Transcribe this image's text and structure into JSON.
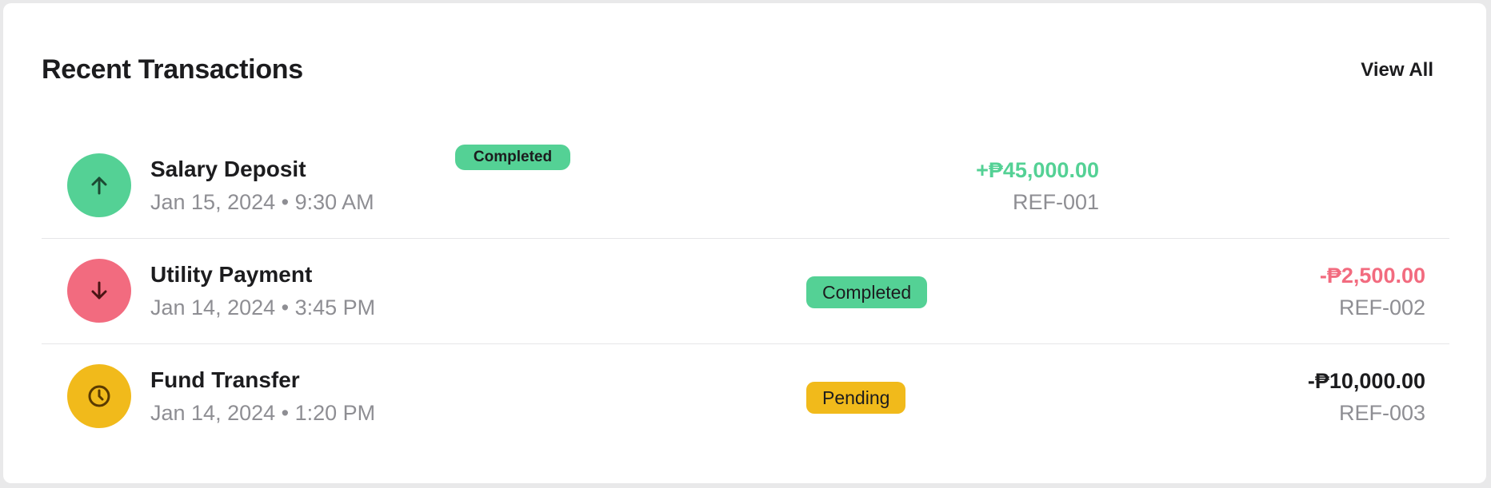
{
  "card": {
    "title": "Recent Transactions",
    "view_all_label": "View All"
  },
  "colors": {
    "green": "#54d195",
    "red": "#f26b7f",
    "yellow": "#f1ba1b",
    "dark_red": "#4a1414",
    "dark_yellow": "#5a3a00"
  },
  "transactions": [
    {
      "name": "Salary Deposit",
      "date": "Jan 15, 2024 • 9:30 AM",
      "status": "Completed",
      "amount": "+₱45,000.00",
      "ref": "REF-001",
      "icon": "arrow-up-icon",
      "amount_color": "#54d195",
      "icon_bg": "#54d195",
      "badge_bg": "#54d195"
    },
    {
      "name": "Utility Payment",
      "date": "Jan 14, 2024 • 3:45 PM",
      "status": "Completed",
      "amount": "-₱2,500.00",
      "ref": "REF-002",
      "icon": "arrow-down-icon",
      "amount_color": "#f26b7f",
      "icon_bg": "#f26b7f",
      "badge_bg": "#54d195"
    },
    {
      "name": "Fund Transfer",
      "date": "Jan 14, 2024 • 1:20 PM",
      "status": "Pending",
      "amount": "-₱10,000.00",
      "ref": "REF-003",
      "icon": "clock-icon",
      "amount_color": "#1c1c1e",
      "icon_bg": "#f1ba1b",
      "badge_bg": "#f1ba1b"
    }
  ]
}
